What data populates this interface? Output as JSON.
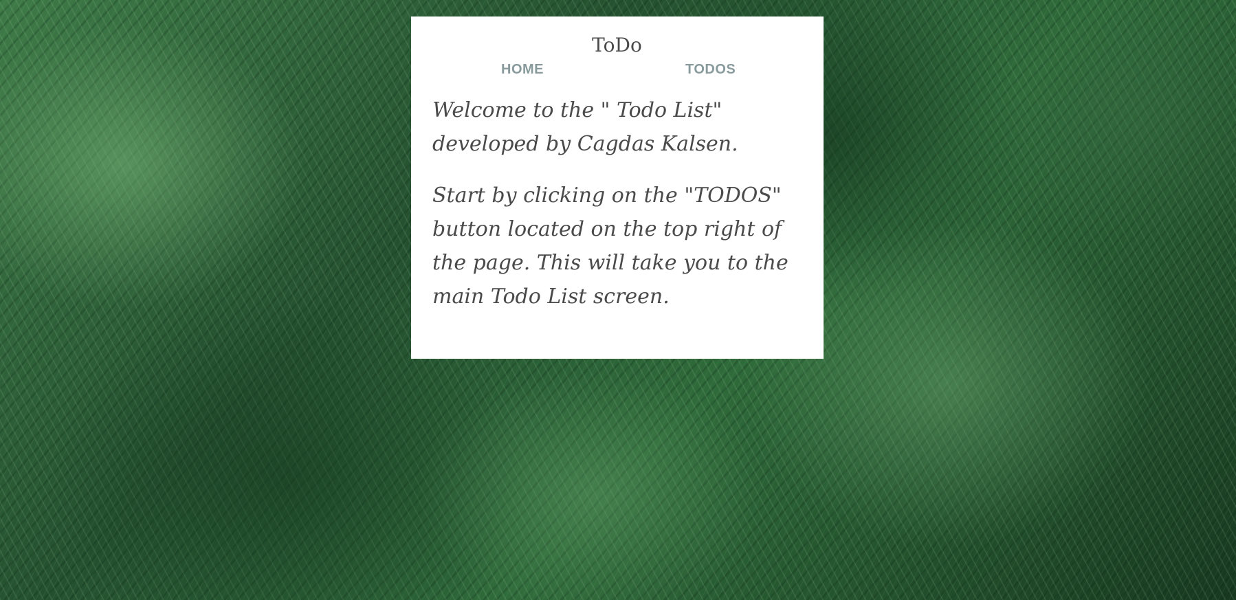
{
  "header": {
    "title": "ToDo"
  },
  "nav": {
    "home_label": "HOME",
    "todos_label": "TODOS"
  },
  "main": {
    "welcome_text": "Welcome to the \" Todo List\" developed by Cagdas Kalsen.",
    "instructions_text": "Start by clicking on the \"TODOS\" button located on the top right of the page. This will take you to the main Todo List screen."
  },
  "colors": {
    "card_background": "#ffffff",
    "text": "#4a4a4a",
    "nav_link": "#889a9c",
    "background_theme": "#2f6a3a"
  }
}
